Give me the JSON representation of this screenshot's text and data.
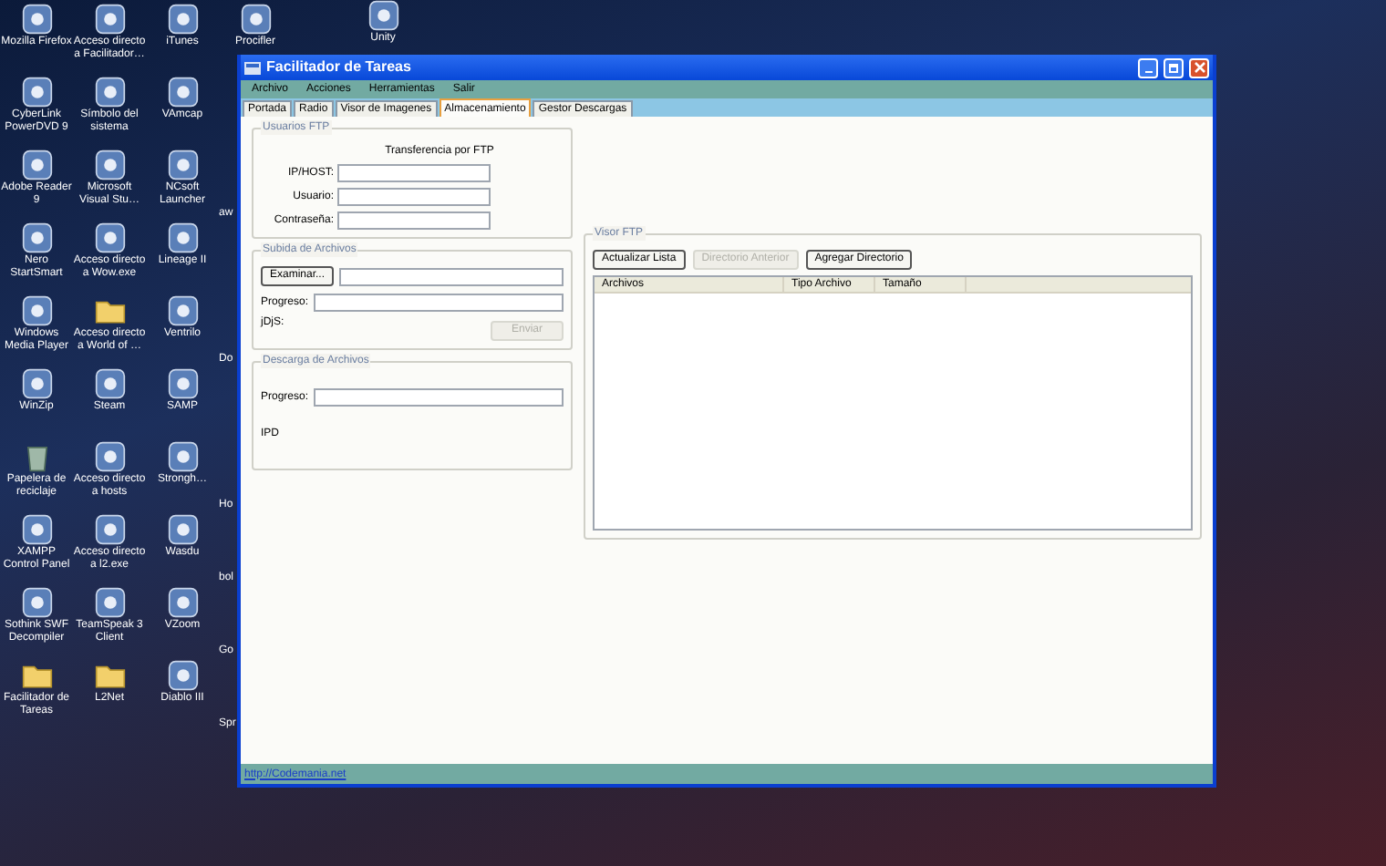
{
  "desktop": {
    "columns": [
      [
        {
          "label": "Mozilla Firefox",
          "kind": "app"
        },
        {
          "label": "CyberLink PowerDVD 9",
          "kind": "app"
        },
        {
          "label": "Adobe Reader 9",
          "kind": "app"
        },
        {
          "label": "Nero StartSmart",
          "kind": "app"
        },
        {
          "label": "Windows Media Player",
          "kind": "app"
        },
        {
          "label": "WinZip",
          "kind": "app"
        },
        {
          "label": "Papelera de reciclaje",
          "kind": "trash"
        },
        {
          "label": "XAMPP Control Panel",
          "kind": "app"
        },
        {
          "label": "Sothink SWF Decompiler",
          "kind": "app"
        },
        {
          "label": "Facilitador de Tareas",
          "kind": "folder"
        }
      ],
      [
        {
          "label": "Acceso directo a Facilitador…",
          "kind": "app"
        },
        {
          "label": "Símbolo del sistema",
          "kind": "app"
        },
        {
          "label": "Microsoft Visual Stu…",
          "kind": "app"
        },
        {
          "label": "Acceso directo a Wow.exe",
          "kind": "app"
        },
        {
          "label": "Acceso directo a World of …",
          "kind": "folder"
        },
        {
          "label": "Steam",
          "kind": "app"
        },
        {
          "label": "Acceso directo a hosts",
          "kind": "app"
        },
        {
          "label": "Acceso directo a l2.exe",
          "kind": "app"
        },
        {
          "label": "TeamSpeak 3 Client",
          "kind": "app"
        },
        {
          "label": "L2Net",
          "kind": "folder"
        }
      ],
      [
        {
          "label": "iTunes",
          "kind": "app"
        },
        {
          "label": "VAmcap",
          "kind": "app"
        },
        {
          "label": "NCsoft Launcher",
          "kind": "app"
        },
        {
          "label": "Lineage II",
          "kind": "app"
        },
        {
          "label": "Ventrilo",
          "kind": "app"
        },
        {
          "label": "SAMP",
          "kind": "app"
        },
        {
          "label": "Strongh…",
          "kind": "app"
        },
        {
          "label": "Wasdu",
          "kind": "app"
        },
        {
          "label": "VZoom",
          "kind": "app"
        },
        {
          "label": "Diablo III",
          "kind": "app"
        }
      ]
    ],
    "top_icons": [
      {
        "label": "Procifler",
        "kind": "app"
      },
      {
        "label": "Unity",
        "kind": "app"
      }
    ],
    "clipped_labels": [
      "aw",
      "Do",
      "Ho",
      "bol",
      "Go",
      "Spr"
    ]
  },
  "window": {
    "title": "Facilitador de Tareas",
    "menu": [
      "Archivo",
      "Acciones",
      "Herramientas",
      "Salir"
    ],
    "tabs": [
      {
        "label": "Portada",
        "selected": false
      },
      {
        "label": "Radio",
        "selected": false
      },
      {
        "label": "Visor de Imagenes",
        "selected": false
      },
      {
        "label": "Almacenamiento",
        "selected": true
      },
      {
        "label": "Gestor Descargas",
        "selected": false
      }
    ],
    "usuarios_ftp": {
      "title": "Usuarios FTP",
      "heading": "Transferencia por FTP",
      "fields": [
        {
          "label": "IP/HOST:"
        },
        {
          "label": "Usuario:"
        },
        {
          "label": "Contraseña:"
        }
      ]
    },
    "subida": {
      "title": "Subida de Archivos",
      "browse_button": "Examinar...",
      "progress_label": "Progreso:",
      "progress": {
        "level": 0
      },
      "status_label": "jDjS:",
      "send_button": {
        "label": "Enviar",
        "disabled": true
      }
    },
    "descarga": {
      "title": "Descarga de Archivos",
      "progress_label": "Progreso:",
      "progress": {
        "level": 0
      },
      "status_label": "IPD"
    },
    "visor_ftp": {
      "title": "Visor FTP",
      "buttons": [
        {
          "label": "Actualizar Lista",
          "disabled": false
        },
        {
          "label": "Directorio Anterior",
          "disabled": true
        },
        {
          "label": "Agregar Directorio",
          "disabled": false
        }
      ],
      "columns": [
        "Archivos",
        "Tipo Archivo",
        "Tamaño"
      ]
    },
    "status_link": "http://Codemania.net"
  }
}
